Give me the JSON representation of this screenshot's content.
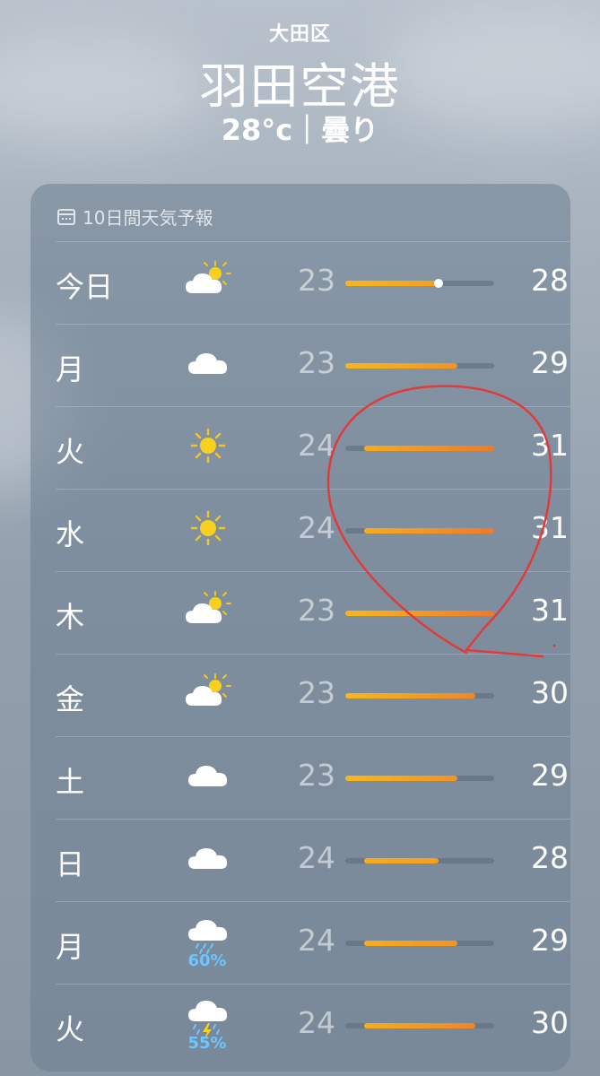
{
  "header": {
    "district": "大田区",
    "location": "羽田空港",
    "current": "28°c｜曇り"
  },
  "forecast": {
    "title": "10日間天気予報",
    "scale_min": 23,
    "scale_max": 31,
    "current_temp": 28,
    "days": [
      {
        "day": "今日",
        "icon": "partly-sunny",
        "low": "23",
        "high": "28"
      },
      {
        "day": "月",
        "icon": "cloud",
        "low": "23",
        "high": "29"
      },
      {
        "day": "火",
        "icon": "sun",
        "low": "24",
        "high": "31"
      },
      {
        "day": "水",
        "icon": "sun",
        "low": "24",
        "high": "31"
      },
      {
        "day": "木",
        "icon": "partly-sunny",
        "low": "23",
        "high": "31"
      },
      {
        "day": "金",
        "icon": "partly-sunny",
        "low": "23",
        "high": "30"
      },
      {
        "day": "土",
        "icon": "cloud",
        "low": "23",
        "high": "29"
      },
      {
        "day": "日",
        "icon": "cloud",
        "low": "24",
        "high": "28"
      },
      {
        "day": "月",
        "icon": "rain",
        "low": "24",
        "high": "29",
        "precip": "60%"
      },
      {
        "day": "火",
        "icon": "thunderstorm",
        "low": "24",
        "high": "30",
        "precip": "55%"
      }
    ]
  }
}
